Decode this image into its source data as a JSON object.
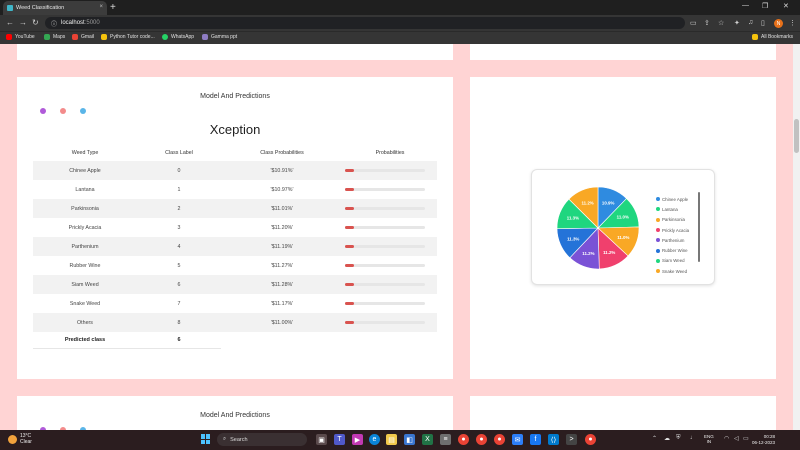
{
  "browser": {
    "tab_title": "Weed Classification",
    "tab_close": "×",
    "new_tab": "+",
    "url_host": "localhost",
    "url_port": ":5000",
    "profile_initial": "N",
    "window_controls": [
      "—",
      "❐",
      "✕"
    ]
  },
  "bookmarks": {
    "items": [
      {
        "label": "YouTube",
        "color": "#ff0000"
      },
      {
        "label": "Maps",
        "color": "#34a853"
      },
      {
        "label": "Gmail",
        "color": "#ea4335"
      },
      {
        "label": "Python Tutor code...",
        "color": "#f4c20d"
      },
      {
        "label": "WhatsApp",
        "color": "#25d366"
      },
      {
        "label": "Gamma ppt",
        "color": "#8e7cc3"
      }
    ],
    "all_bookmarks": "All Bookmarks"
  },
  "main": {
    "section_title": "Model And Predictions",
    "model_name": "Xception",
    "dot_colors": [
      "#b05ad9",
      "#f38b8b",
      "#5ab5e8"
    ],
    "columns": [
      "Weed Type",
      "Class Label",
      "Class Probabilities",
      "Probabilities"
    ],
    "rows": [
      {
        "type": "Chinee Apple",
        "label": "0",
        "prob_text": "'$10.91%'",
        "prob": 10.91
      },
      {
        "type": "Lantana",
        "label": "1",
        "prob_text": "'$10.97%'",
        "prob": 10.97
      },
      {
        "type": "Parkinsonia",
        "label": "2",
        "prob_text": "'$11.01%'",
        "prob": 11.01
      },
      {
        "type": "Prickly Acacia",
        "label": "3",
        "prob_text": "'$11.20%'",
        "prob": 11.2
      },
      {
        "type": "Parthenium",
        "label": "4",
        "prob_text": "'$11.19%'",
        "prob": 11.19
      },
      {
        "type": "Rubber Wine",
        "label": "5",
        "prob_text": "'$11.27%'",
        "prob": 11.27
      },
      {
        "type": "Siam Weed",
        "label": "6",
        "prob_text": "'$11.28%'",
        "prob": 11.28
      },
      {
        "type": "Snake Weed",
        "label": "7",
        "prob_text": "'$11.17%'",
        "prob": 11.17
      },
      {
        "type": "Others",
        "label": "8",
        "prob_text": "'$11.00%'",
        "prob": 11.0
      }
    ],
    "predicted_label": "Predicted class",
    "predicted_value": "6"
  },
  "chart_data": {
    "type": "pie",
    "categories": [
      "Chinee Apple",
      "Lantana",
      "Parkinsonia",
      "Prickly Acacia",
      "Parthenium",
      "Rubber Wine",
      "Siam Weed",
      "Snake Weed"
    ],
    "values": [
      10.9,
      11.0,
      11.0,
      11.2,
      11.2,
      11.3,
      11.3,
      11.2
    ],
    "slice_labels": [
      "10.9%",
      "11.0%",
      "11.0%",
      "11.2%",
      "11.2%",
      "11.3%",
      "11.3%",
      "11.2%"
    ],
    "colors": [
      "#2f8be0",
      "#1fd67f",
      "#f9a825",
      "#f0406d",
      "#7a52d6",
      "#2473d8",
      "#1fd67f",
      "#f9a825"
    ],
    "legend_position": "right"
  },
  "bottom": {
    "section_title": "Model And Predictions"
  },
  "taskbar": {
    "temp": "13°C",
    "condition": "Clear",
    "search_placeholder": "Search",
    "lang_line1": "ENG",
    "lang_line2": "IN",
    "time": "00:28",
    "date": "06-12-2023"
  }
}
